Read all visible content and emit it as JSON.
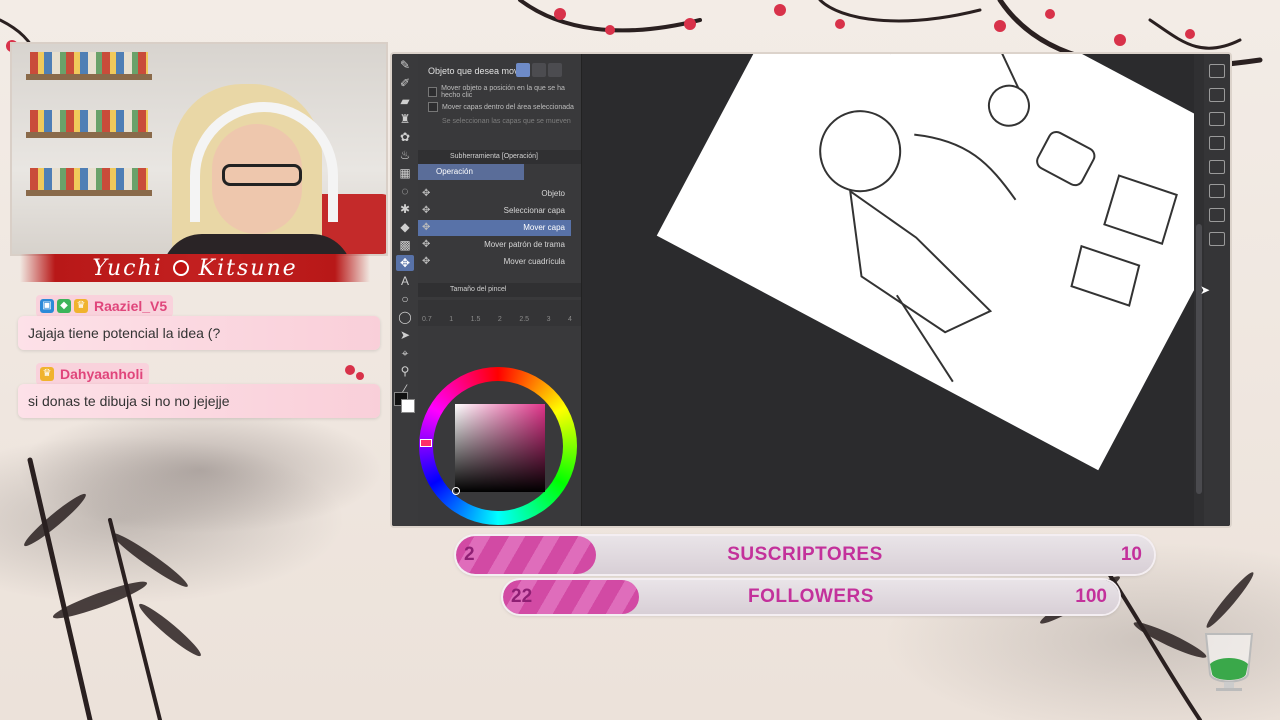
{
  "streamer": {
    "name_first": "Yuchi",
    "name_last": "Kitsune"
  },
  "chat": {
    "messages": [
      {
        "user": "Raaziel_V5",
        "text": "Jajaja tiene potencial la idea (?",
        "badges": [
          "prime-icon",
          "gem-icon",
          "crown-icon"
        ]
      },
      {
        "user": "Dahyaanholi",
        "text": "si donas te dibuja si no no jejejje",
        "badges": [
          "crown-icon"
        ]
      }
    ]
  },
  "app": {
    "tool_property": {
      "target_label": "Objeto que desea mover",
      "option_1": "Mover objeto a posición en la que se ha hecho clic",
      "option_2": "Mover capas dentro del área seleccionada",
      "note": "Se seleccionan las capas que se mueven"
    },
    "subtool": {
      "title": "Subherramienta [Operación]",
      "group": "Operación",
      "items": [
        "Objeto",
        "Seleccionar capa",
        "Mover capa",
        "Mover patrón de trama",
        "Mover cuadrícula"
      ],
      "selected": "Mover capa"
    },
    "brush_size": {
      "title": "Tamaño del pincel",
      "sizes": [
        "0.7",
        "1",
        "1.5",
        "2",
        "2.5",
        "3",
        "4"
      ]
    },
    "colors": {
      "foreground": "#000000",
      "background": "#ffffff"
    }
  },
  "goals": {
    "subscribers": {
      "label": "SUSCRIPTORES",
      "current": 2,
      "target": 10,
      "current_text": "2",
      "target_text": "10"
    },
    "followers": {
      "label": "FOLLOWERS",
      "current": 22,
      "target": 100,
      "current_text": "22",
      "target_text": "100"
    }
  },
  "colors": {
    "accent_pink": "#d24aa4",
    "banner_red": "#c21f1f",
    "chat_name": "#e0457b"
  }
}
